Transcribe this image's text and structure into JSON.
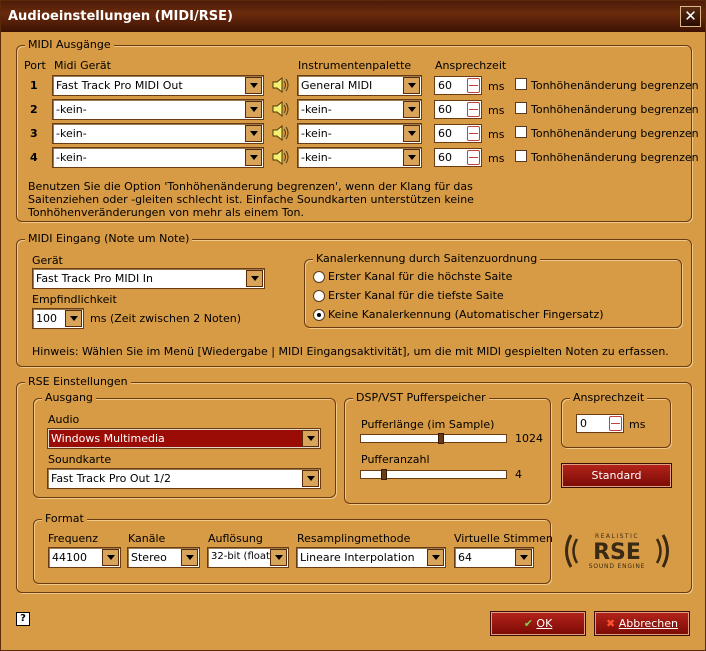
{
  "window": {
    "title": "Audioeinstellungen (MIDI/RSE)"
  },
  "midi_out": {
    "legend": "MIDI Ausgänge",
    "headers": {
      "port": "Port",
      "device": "Midi Gerät",
      "palette": "Instrumentenpalette",
      "latency": "Ansprechzeit"
    },
    "rows": [
      {
        "port": "1",
        "device": "Fast Track Pro MIDI Out",
        "palette": "General MIDI",
        "latency": "60",
        "unit": "ms",
        "limit_label": "Tonhöhenänderung begrenzen",
        "limit_checked": false
      },
      {
        "port": "2",
        "device": "-kein-",
        "palette": "-kein-",
        "latency": "60",
        "unit": "ms",
        "limit_label": "Tonhöhenänderung begrenzen",
        "limit_checked": false
      },
      {
        "port": "3",
        "device": "-kein-",
        "palette": "-kein-",
        "latency": "60",
        "unit": "ms",
        "limit_label": "Tonhöhenänderung begrenzen",
        "limit_checked": false
      },
      {
        "port": "4",
        "device": "-kein-",
        "palette": "-kein-",
        "latency": "60",
        "unit": "ms",
        "limit_label": "Tonhöhenänderung begrenzen",
        "limit_checked": false
      }
    ],
    "note_lines": [
      "Benutzen Sie die Option 'Tonhöhenänderung begrenzen', wenn der Klang für das",
      "Saitenziehen oder -gleiten schlecht ist. Einfache Soundkarten unterstützen keine",
      "Tonhöhenveränderungen von mehr als einem Ton."
    ]
  },
  "midi_in": {
    "legend": "MIDI Eingang (Note um Note)",
    "device_label": "Gerät",
    "device": "Fast Track Pro MIDI In",
    "sensitivity_label": "Empfindlichkeit",
    "sensitivity": "100",
    "sensitivity_unit": "ms (Zeit zwischen 2 Noten)",
    "channel_legend": "Kanalerkennung durch Saitenzuordnung",
    "channel_options": [
      {
        "label": "Erster Kanal für die höchste Saite",
        "selected": false
      },
      {
        "label": "Erster Kanal für die tiefste Saite",
        "selected": false
      },
      {
        "label": "Keine Kanalerkennung (Automatischer Fingersatz)",
        "selected": true
      }
    ],
    "hint": "Hinweis: Wählen Sie im Menü [Wiedergabe | MIDI Eingangsaktivität], um die mit MIDI gespielten Noten zu erfassen."
  },
  "rse": {
    "legend": "RSE Einstellungen",
    "output_legend": "Ausgang",
    "audio_label": "Audio",
    "audio": "Windows Multimedia",
    "soundcard_label": "Soundkarte",
    "soundcard": "Fast Track Pro Out 1/2",
    "dsp_legend": "DSP/VST Pufferspeicher",
    "buffer_length_label": "Pufferlänge (im Sample)",
    "buffer_length": "1024",
    "buffer_length_level": 0.55,
    "buffer_count_label": "Pufferanzahl",
    "buffer_count": "4",
    "buffer_count_level": 0.15,
    "latency_legend": "Ansprechzeit",
    "latency": "0",
    "latency_unit": "ms",
    "standard_button": "Standard",
    "format_legend": "Format",
    "format": {
      "frequency_label": "Frequenz",
      "frequency": "44100",
      "channels_label": "Kanäle",
      "channels": "Stereo",
      "resolution_label": "Auflösung",
      "resolution": "32-bit (float)",
      "resampling_label": "Resamplingmethode",
      "resampling": "Lineare Interpolation",
      "voices_label": "Virtuelle Stimmen",
      "voices": "64"
    },
    "logo": {
      "top": "REALISTIC",
      "main": "RSE",
      "bottom": "SOUND ENGINE"
    }
  },
  "footer": {
    "help_icon": "?",
    "ok": "OK",
    "cancel": "Abbrechen"
  },
  "colors": {
    "background": "#D79B45",
    "accent_red": "#9c0c06",
    "title_bar": "#4d1c08"
  }
}
